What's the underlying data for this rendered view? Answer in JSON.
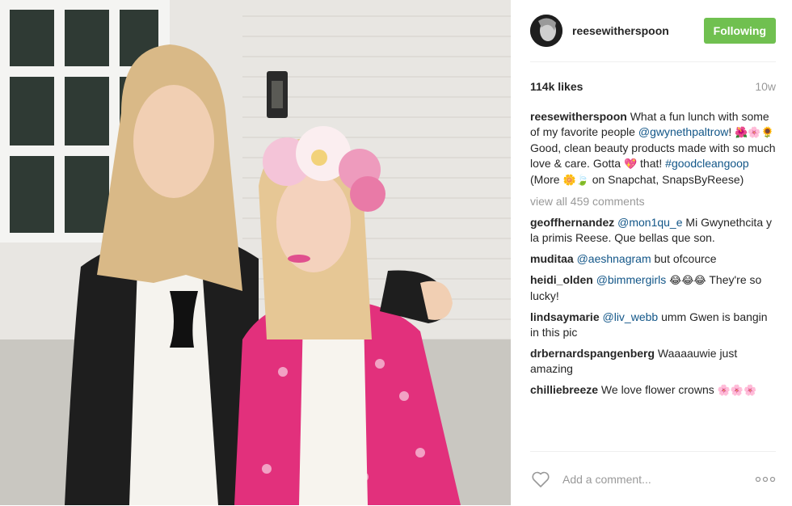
{
  "post": {
    "photo_alt": "",
    "username": "reesewitherspoon",
    "follow_label": "Following",
    "likes": "114k likes",
    "age": "10w"
  },
  "caption": {
    "username": "reesewitherspoon",
    "text_a": " What a fun lunch with some of my favorite people ",
    "mention": "@gwynethpaltrow",
    "text_b": "! ",
    "emoji_a": "🌺🌸🌻",
    "text_c": " Good, clean beauty products made with so much love & care. Gotta ",
    "emoji_b": "💖",
    "text_d": " that! ",
    "hashtag": "#goodcleangoop",
    "text_e": " (More ",
    "emoji_c": "🌼🍃",
    "text_f": " on Snapchat, SnapsByReese)"
  },
  "view_all": "view all 459 comments",
  "comments": [
    {
      "username": "geoffhernandez",
      "mention": "@mon1qu_e",
      "text": " Mi Gwynethcita y la primis Reese. Que bellas que son.",
      "emoji": ""
    },
    {
      "username": "muditaa",
      "mention": "@aeshnagram",
      "text": " but ofcource",
      "emoji": ""
    },
    {
      "username": "heidi_olden",
      "mention": "@bimmergirls",
      "text": " ",
      "emoji": "😂😂😂",
      "text2": " They're so lucky!"
    },
    {
      "username": "lindsaymarie",
      "mention": "@liv_webb",
      "text": " umm Gwen is bangin in this pic",
      "emoji": ""
    },
    {
      "username": "drbernardspangenberg",
      "mention": "",
      "text": " Waaaauwie just amazing",
      "emoji": ""
    },
    {
      "username": "chilliebreeze",
      "mention": "",
      "text": " We love flower crowns ",
      "emoji": "🌸🌸🌸"
    }
  ],
  "add_comment": {
    "placeholder": "Add a comment..."
  },
  "icons": {
    "heart": "heart-icon",
    "more": "more-options-icon"
  },
  "colors": {
    "follow": "#70c050",
    "link": "#125688",
    "muted": "#999999"
  }
}
